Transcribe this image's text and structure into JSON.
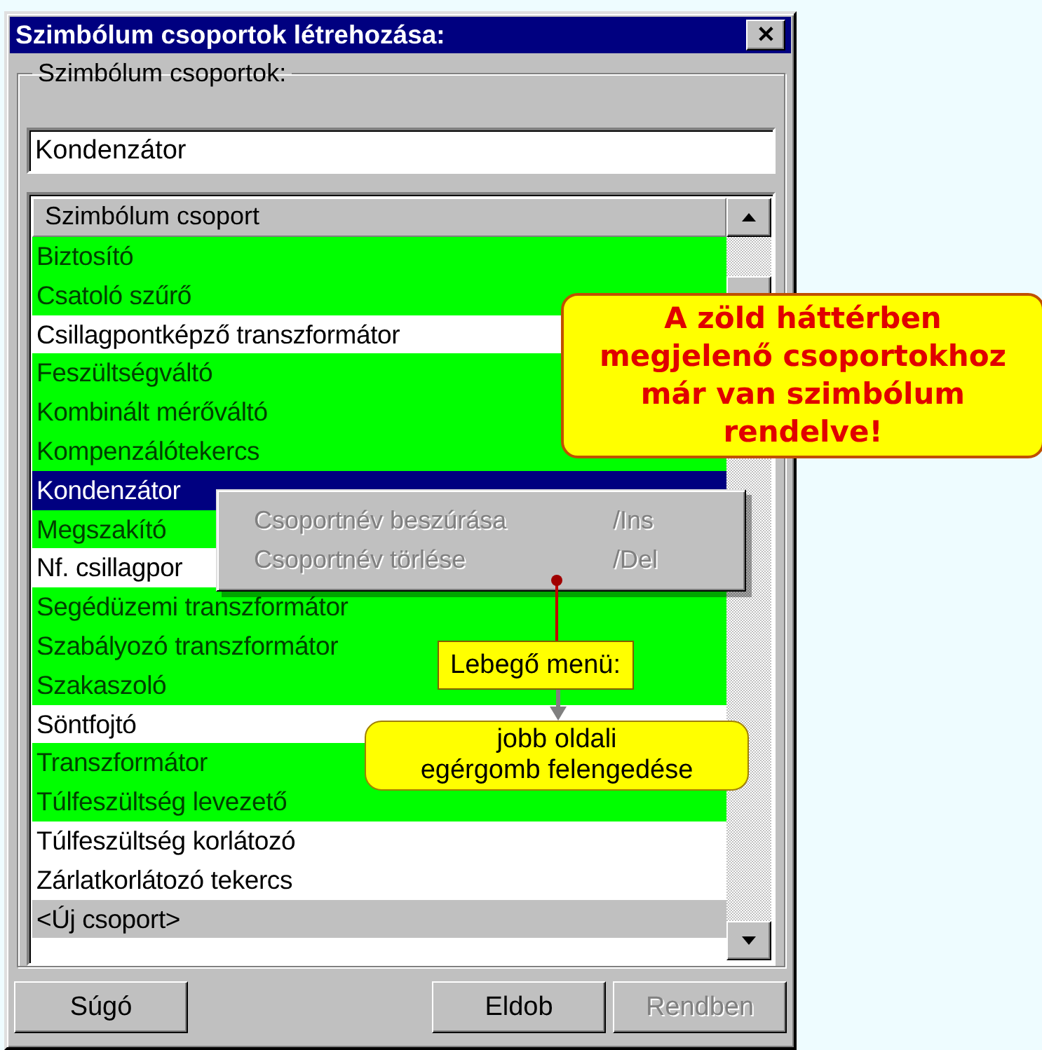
{
  "window": {
    "title": "Szimbólum csoportok létrehozása:",
    "close_label": "✕"
  },
  "group": {
    "label": "Szimbólum csoportok:",
    "field": {
      "value": "Kondenzátor"
    }
  },
  "list": {
    "header": "Szimbólum csoport",
    "rows": [
      {
        "label": "Biztosító",
        "kind": "assigned",
        "selected": false
      },
      {
        "label": "Csatoló szűrő",
        "kind": "assigned",
        "selected": false
      },
      {
        "label": "Csillagpontképző transzformátor",
        "kind": "plain",
        "selected": false
      },
      {
        "label": "Feszültségváltó",
        "kind": "assigned",
        "selected": false
      },
      {
        "label": "Kombinált mérőváltó",
        "kind": "assigned",
        "selected": false
      },
      {
        "label": "Kompenzálótekercs",
        "kind": "assigned",
        "selected": false
      },
      {
        "label": "Kondenzátor",
        "kind": "assigned",
        "selected": true
      },
      {
        "label": "Megszakító",
        "kind": "assigned",
        "selected": false
      },
      {
        "label": "Nf. csillagpor",
        "kind": "plain",
        "selected": false
      },
      {
        "label": "Segédüzemi transzformátor",
        "kind": "assigned",
        "selected": false
      },
      {
        "label": "Szabályozó transzformátor",
        "kind": "assigned",
        "selected": false
      },
      {
        "label": "Szakaszoló",
        "kind": "assigned",
        "selected": false
      },
      {
        "label": "Söntfojtó",
        "kind": "plain",
        "selected": false
      },
      {
        "label": "Transzformátor",
        "kind": "assigned",
        "selected": false
      },
      {
        "label": "Túlfeszültség levezető",
        "kind": "assigned",
        "selected": false
      },
      {
        "label": "Túlfeszültség korlátozó",
        "kind": "plain",
        "selected": false
      },
      {
        "label": "Zárlatkorlátozó tekercs",
        "kind": "plain",
        "selected": false
      },
      {
        "label": "<Új csoport>",
        "kind": "new",
        "selected": false
      }
    ]
  },
  "context_menu": {
    "items": [
      {
        "label": "Csoportnév beszúrása",
        "shortcut": "/Ins",
        "disabled": true
      },
      {
        "label": "Csoportnév törlése",
        "shortcut": "/Del",
        "disabled": true
      }
    ]
  },
  "annotations": {
    "note": [
      "A zöld háttérben",
      "megjelenő csoportokhoz",
      "már van szimbólum",
      "rendelve!"
    ],
    "menu_label": "Lebegő menü:",
    "hint": [
      "jobb oldali",
      "egérgomb felengedése"
    ]
  },
  "buttons": [
    {
      "label": "Súgó",
      "disabled": false
    },
    {
      "label": "Eldob",
      "disabled": false
    },
    {
      "label": "Rendben",
      "disabled": true
    }
  ]
}
